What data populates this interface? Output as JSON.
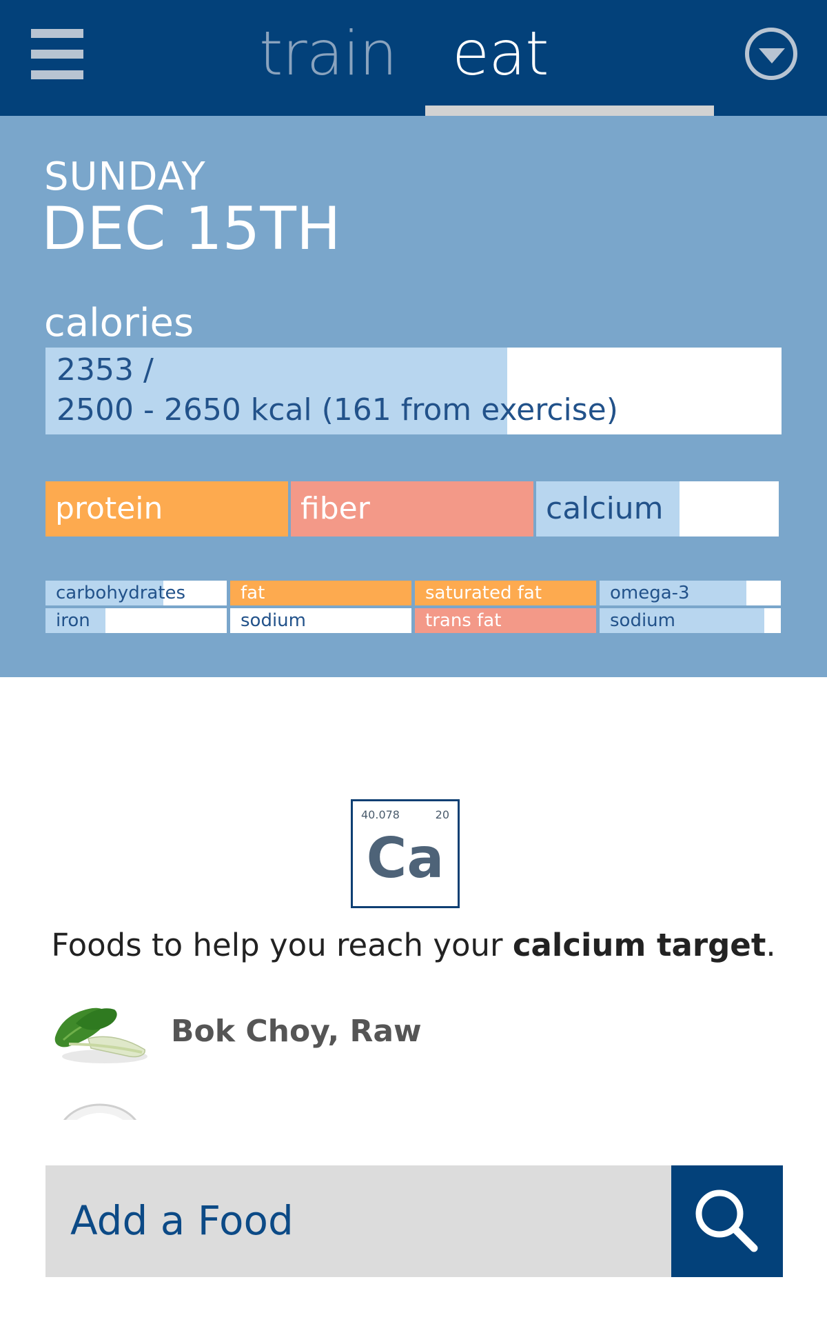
{
  "header": {
    "tabs": [
      {
        "label": "train",
        "active": false
      },
      {
        "label": "eat",
        "active": true
      }
    ],
    "menu_icon": "hamburger-icon",
    "dropdown_icon": "chevron-down-circle-icon",
    "bar_color": "#03417a"
  },
  "summary": {
    "day": "SUNDAY",
    "date": "DEC 15TH",
    "calories": {
      "label": "calories",
      "line1": "2353 /",
      "line2": "2500 - 2650 kcal (161 from exercise)",
      "fill_fraction": 0.627
    },
    "nutrients_primary": [
      {
        "label": "protein",
        "fill": 1.0,
        "color": "#fdaa4f",
        "text_color": "#ffffff"
      },
      {
        "label": "fiber",
        "fill": 1.0,
        "color": "#f39988",
        "text_color": "#ffffff"
      },
      {
        "label": "calcium",
        "fill": 0.59,
        "color": "#b8d6ef",
        "text_color": "#22528a"
      }
    ],
    "nutrients_secondary": [
      {
        "label": "carbohydrates",
        "fill": 0.65,
        "color": "#b8d6ef",
        "text_color": "#22528a"
      },
      {
        "label": "fat",
        "fill": 1.0,
        "color": "#fdaa4f",
        "text_color": "#ffffff"
      },
      {
        "label": "saturated fat",
        "fill": 1.0,
        "color": "#fdaa4f",
        "text_color": "#ffffff"
      },
      {
        "label": "omega-3",
        "fill": 0.81,
        "color": "#b8d6ef",
        "text_color": "#22528a"
      },
      {
        "label": "iron",
        "fill": 0.33,
        "color": "#b8d6ef",
        "text_color": "#22528a"
      },
      {
        "label": "sodium",
        "fill": 0.0,
        "color": "#b8d6ef",
        "text_color": "#22528a"
      },
      {
        "label": "trans fat",
        "fill": 1.0,
        "color": "#f39988",
        "text_color": "#ffffff"
      },
      {
        "label": "sodium",
        "fill": 0.91,
        "color": "#b8d6ef",
        "text_color": "#22528a"
      }
    ]
  },
  "element_tile": {
    "atomic_mass": "40.078",
    "atomic_number": "20",
    "symbol": "Ca"
  },
  "tip": {
    "prefix": "Foods to help you reach your ",
    "emphasis": "calcium target",
    "suffix": "."
  },
  "foods": [
    {
      "name": "Bok Choy, Raw",
      "icon": "bok-choy-image"
    }
  ],
  "add_food": {
    "placeholder": "Add a Food",
    "search_icon": "search-icon"
  }
}
